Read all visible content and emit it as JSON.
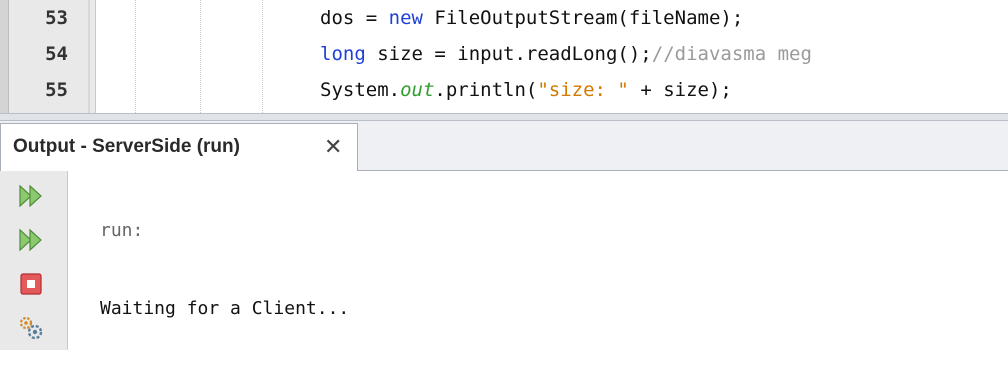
{
  "editor": {
    "lines": [
      {
        "number": "53",
        "segments": [
          {
            "text": "dos = ",
            "cls": ""
          },
          {
            "text": "new",
            "cls": "kw"
          },
          {
            "text": " FileOutputStream(fileName);",
            "cls": ""
          }
        ]
      },
      {
        "number": "54",
        "segments": [
          {
            "text": "long",
            "cls": "kw"
          },
          {
            "text": " size = input.readLong();",
            "cls": ""
          },
          {
            "text": "//diavasma meg",
            "cls": "cm"
          }
        ]
      },
      {
        "number": "55",
        "segments": [
          {
            "text": "System.",
            "cls": ""
          },
          {
            "text": "out",
            "cls": "fld"
          },
          {
            "text": ".println(",
            "cls": ""
          },
          {
            "text": "\"size: \"",
            "cls": "str"
          },
          {
            "text": " + size);",
            "cls": ""
          }
        ]
      }
    ]
  },
  "output": {
    "tab_label": "Output - ServerSide (run)",
    "close_glyph": "✕",
    "lines": [
      {
        "text": "run:",
        "cls": "muted"
      },
      {
        "text": "Waiting for a Client...",
        "cls": "plain"
      }
    ],
    "toolbar": {
      "rerun_icon": "rerun-icon",
      "rerun_different_icon": "rerun-with-options-icon",
      "stop_icon": "stop-icon",
      "settings_icon": "settings-icon"
    }
  },
  "colors": {
    "keyword": "#1f3fd6",
    "comment": "#9a9a9a",
    "string": "#d27a00",
    "field": "#2e9e2e",
    "run_green": "#6ab04c",
    "stop_red": "#e04a4a"
  }
}
